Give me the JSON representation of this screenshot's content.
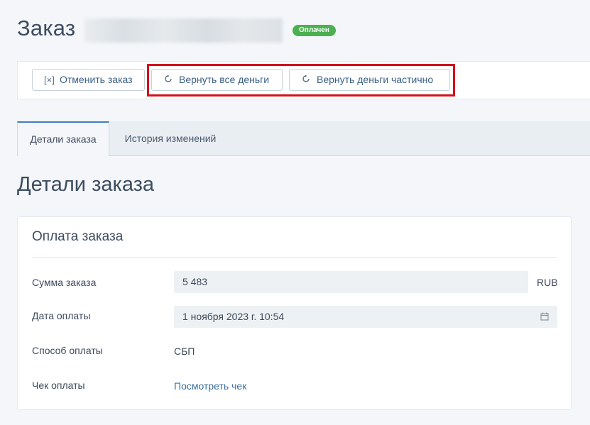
{
  "header": {
    "title": "Заказ",
    "status_badge": "Оплачен",
    "status_color": "#4caf50"
  },
  "toolbar": {
    "cancel_label": "Отменить заказ",
    "cancel_icon": "cancel-bracket-icon",
    "refund_all_label": "Вернуть все деньги",
    "refund_partial_label": "Вернуть деньги частично",
    "refund_icon": "refresh-icon",
    "highlight_color": "#d3111b"
  },
  "tabs": [
    {
      "label": "Детали заказа",
      "active": true
    },
    {
      "label": "История изменений",
      "active": false
    }
  ],
  "section_title": "Детали заказа",
  "payment": {
    "title": "Оплата заказа",
    "amount_label": "Сумма заказа",
    "amount_value": "5 483",
    "currency": "RUB",
    "date_label": "Дата оплаты",
    "date_value": "1 ноября 2023 г. 10:54",
    "method_label": "Способ оплаты",
    "method_value": "СБП",
    "receipt_label": "Чек оплаты",
    "receipt_link": "Посмотреть чек"
  }
}
